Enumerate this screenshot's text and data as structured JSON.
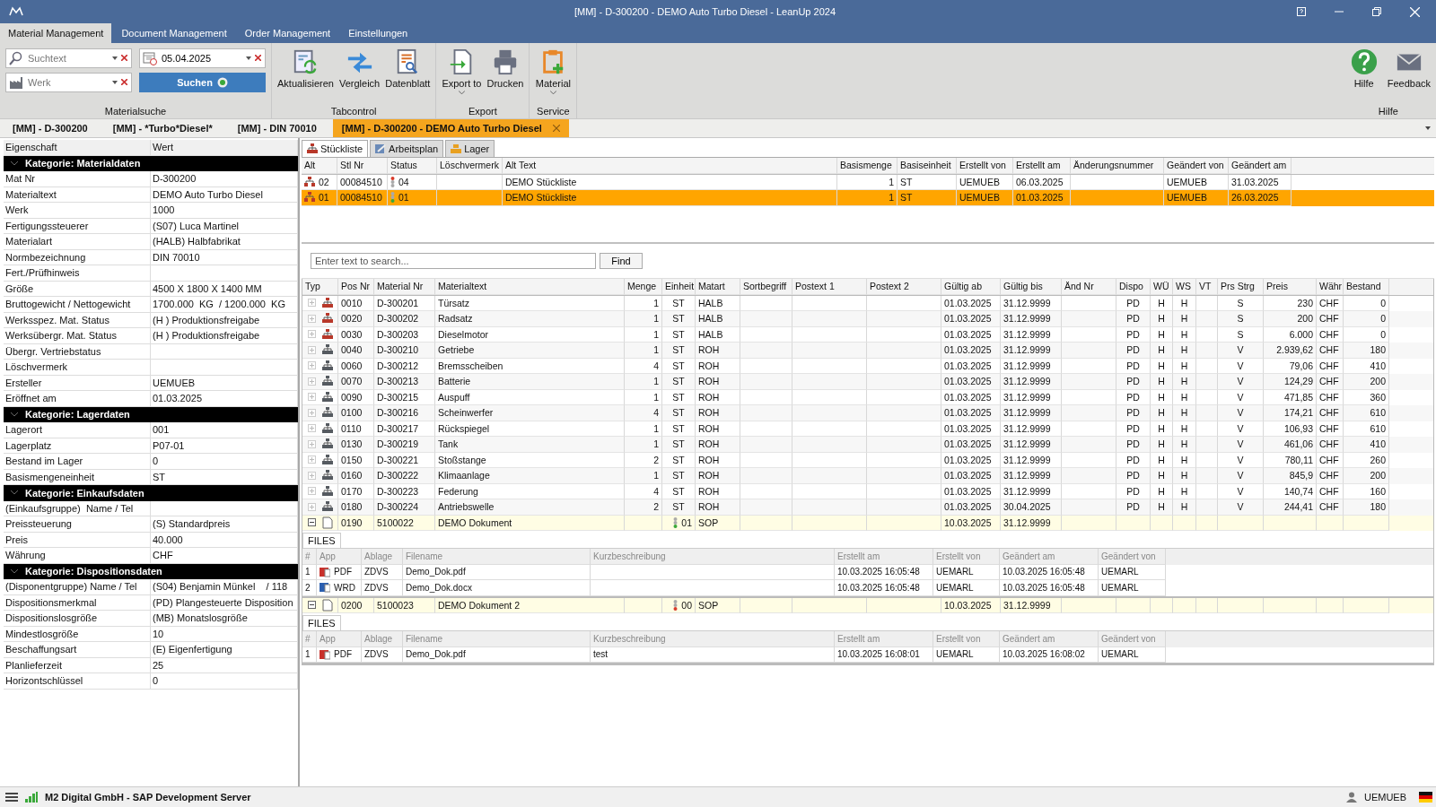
{
  "window": {
    "title": "[MM] - D-300200 - DEMO Auto Turbo Diesel - LeanUp 2024"
  },
  "ribbon_tabs": [
    {
      "label": "Material Management",
      "selected": true
    },
    {
      "label": "Document Management",
      "selected": false
    },
    {
      "label": "Order Management",
      "selected": false
    },
    {
      "label": "Einstellungen",
      "selected": false
    }
  ],
  "material_search": {
    "label": "Materialsuche",
    "search_placeholder": "Suchtext",
    "date": "05.04.2025",
    "plant_placeholder": "Werk",
    "button": "Suchen"
  },
  "ribbon_groups": [
    {
      "label": "Tabcontrol",
      "buttons": [
        {
          "label": "Aktualisieren",
          "dropdown": false
        },
        {
          "label": "Vergleich",
          "dropdown": false
        },
        {
          "label": "Datenblatt",
          "dropdown": false
        }
      ]
    },
    {
      "label": "Export",
      "buttons": [
        {
          "label": "Export to",
          "dropdown": true
        },
        {
          "label": "Drucken",
          "dropdown": false
        }
      ]
    },
    {
      "label": "Service",
      "buttons": [
        {
          "label": "Material",
          "dropdown": true
        }
      ]
    },
    {
      "label": "Hilfe",
      "buttons": [
        {
          "label": "Hilfe",
          "dropdown": false
        },
        {
          "label": "Feedback",
          "dropdown": false
        }
      ]
    }
  ],
  "document_tabs": [
    {
      "label": "[MM] - D-300200",
      "selected": false
    },
    {
      "label": "[MM] - *Turbo*Diesel*",
      "selected": false
    },
    {
      "label": "[MM] - DIN 70010",
      "selected": false
    },
    {
      "label": "[MM] - D-300200 - DEMO Auto Turbo Diesel",
      "selected": true
    }
  ],
  "property_grid": {
    "columns": [
      "Eigenschaft",
      "Wert"
    ],
    "categories": [
      {
        "title": "Kategorie: Materialdaten",
        "expanded": true,
        "rows": [
          [
            "Mat Nr",
            "D-300200"
          ],
          [
            "Materialtext",
            "DEMO Auto Turbo Diesel"
          ],
          [
            "Werk",
            "1000"
          ],
          [
            "Fertigungssteuerer",
            "(S07) Luca Martinel"
          ],
          [
            "Materialart",
            "(HALB) Halbfabrikat"
          ],
          [
            "Normbezeichnung",
            "DIN 70010"
          ],
          [
            "Fert./Prüfhinweis",
            null
          ],
          [
            "Größe",
            "4500 X 1800 X 1400 MM"
          ],
          [
            "Bruttogewicht / Nettogewicht",
            "1700.000  KG  / 1200.000  KG"
          ],
          [
            "Werksspez. Mat. Status",
            "(H ) Produktionsfreigabe"
          ],
          [
            "Werksübergr. Mat. Status",
            "(H ) Produktionsfreigabe"
          ],
          [
            "Übergr. Vertriebstatus",
            null
          ],
          [
            "Löschvermerk",
            null
          ],
          [
            "Ersteller",
            "UEMUEB"
          ],
          [
            "Eröffnet am",
            "01.03.2025"
          ]
        ]
      },
      {
        "title": "Kategorie: Lagerdaten",
        "expanded": true,
        "rows": [
          [
            "Lagerort",
            "001"
          ],
          [
            "Lagerplatz",
            "P07-01"
          ],
          [
            "Bestand im Lager",
            "0"
          ],
          [
            "Basismengeneinheit",
            "ST"
          ]
        ]
      },
      {
        "title": "Kategorie: Einkaufsdaten",
        "expanded": true,
        "rows": [
          [
            "(Einkaufsgruppe)  Name / Tel",
            null
          ],
          [
            "Preissteuerung",
            "(S) Standardpreis"
          ],
          [
            "Preis",
            "40.000"
          ],
          [
            "Währung",
            "CHF"
          ]
        ]
      },
      {
        "title": "Kategorie: Dispositionsdaten",
        "expanded": true,
        "rows": [
          [
            "(Disponentgruppe) Name / Tel",
            "(S04) Benjamin Münkel    / 118"
          ],
          [
            "Dispositionsmerkmal",
            "(PD) Plangesteuerte Disposition"
          ],
          [
            "Dispositionslosgröße",
            "(MB) Monatslosgröße"
          ],
          [
            "Mindestlosgröße",
            "10"
          ],
          [
            "Beschaffungsart",
            "(E) Eigenfertigung"
          ],
          [
            "Planlieferzeit",
            "25"
          ],
          [
            "Horizontschlüssel",
            "0"
          ]
        ]
      }
    ]
  },
  "sub_tabs": [
    {
      "label": "Stückliste",
      "selected": true
    },
    {
      "label": "Arbeitsplan",
      "selected": false
    },
    {
      "label": "Lager",
      "selected": false
    }
  ],
  "bom_versions": {
    "columns": [
      "Alt",
      "Stl Nr",
      "Status",
      "Löschvermerk",
      "Alt Text",
      "Basismenge",
      "Basiseinheit",
      "Erstellt von",
      "Erstellt am",
      "Änderungsnummer",
      "Geändert von",
      "Geändert am"
    ],
    "rows": [
      {
        "selected": false,
        "color": "#d83b2b",
        "cells": [
          "02",
          "00084510",
          "04",
          null,
          "DEMO Stückliste",
          "1",
          "ST",
          "UEMUEB",
          "06.03.2025",
          null,
          "UEMUEB",
          "31.03.2025"
        ]
      },
      {
        "selected": true,
        "color": "#3aa83a",
        "cells": [
          "01",
          "00084510",
          "01",
          null,
          "DEMO Stückliste",
          "1",
          "ST",
          "UEMUEB",
          "01.03.2025",
          null,
          "UEMUEB",
          "26.03.2025"
        ]
      }
    ]
  },
  "find": {
    "placeholder": "Enter text to search...",
    "button": "Find"
  },
  "items": {
    "type_column": "Typ",
    "columns": [
      "Pos Nr",
      "Material Nr",
      "Materialtext",
      "Menge",
      "Einheit",
      "Matart",
      "Sortbegriff",
      "Postext 1",
      "Postext 2",
      "Gültig ab",
      "Gültig bis",
      "Änd Nr",
      "Dispo",
      "WÜ",
      "WS",
      "VT",
      "Prs Strg",
      "Preis",
      "Währ",
      "Bestand"
    ],
    "rows": [
      {
        "kind": "halb",
        "expanded": false,
        "cells": [
          "0010",
          "D-300201",
          "Türsatz",
          "1",
          "ST",
          "HALB",
          null,
          null,
          null,
          "01.03.2025",
          "31.12.9999",
          null,
          "PD",
          "H",
          "H",
          null,
          "S",
          "230",
          "CHF",
          "0"
        ]
      },
      {
        "kind": "halb",
        "expanded": false,
        "cells": [
          "0020",
          "D-300202",
          "Radsatz",
          "1",
          "ST",
          "HALB",
          null,
          null,
          null,
          "01.03.2025",
          "31.12.9999",
          null,
          "PD",
          "H",
          "H",
          null,
          "S",
          "200",
          "CHF",
          "0"
        ]
      },
      {
        "kind": "halb",
        "expanded": false,
        "cells": [
          "0030",
          "D-300203",
          "Dieselmotor",
          "1",
          "ST",
          "HALB",
          null,
          null,
          null,
          "01.03.2025",
          "31.12.9999",
          null,
          "PD",
          "H",
          "H",
          null,
          "S",
          "6.000",
          "CHF",
          "0"
        ]
      },
      {
        "kind": "roh",
        "expanded": false,
        "cells": [
          "0040",
          "D-300210",
          "Getriebe",
          "1",
          "ST",
          "ROH",
          null,
          null,
          null,
          "01.03.2025",
          "31.12.9999",
          null,
          "PD",
          "H",
          "H",
          null,
          "V",
          "2.939,62",
          "CHF",
          "180"
        ]
      },
      {
        "kind": "roh",
        "expanded": false,
        "cells": [
          "0060",
          "D-300212",
          "Bremsscheiben",
          "4",
          "ST",
          "ROH",
          null,
          null,
          null,
          "01.03.2025",
          "31.12.9999",
          null,
          "PD",
          "H",
          "H",
          null,
          "V",
          "79,06",
          "CHF",
          "410"
        ]
      },
      {
        "kind": "roh",
        "expanded": false,
        "cells": [
          "0070",
          "D-300213",
          "Batterie",
          "1",
          "ST",
          "ROH",
          null,
          null,
          null,
          "01.03.2025",
          "31.12.9999",
          null,
          "PD",
          "H",
          "H",
          null,
          "V",
          "124,29",
          "CHF",
          "200"
        ]
      },
      {
        "kind": "roh",
        "expanded": false,
        "cells": [
          "0090",
          "D-300215",
          "Auspuff",
          "1",
          "ST",
          "ROH",
          null,
          null,
          null,
          "01.03.2025",
          "31.12.9999",
          null,
          "PD",
          "H",
          "H",
          null,
          "V",
          "471,85",
          "CHF",
          "360"
        ]
      },
      {
        "kind": "roh",
        "expanded": false,
        "cells": [
          "0100",
          "D-300216",
          "Scheinwerfer",
          "4",
          "ST",
          "ROH",
          null,
          null,
          null,
          "01.03.2025",
          "31.12.9999",
          null,
          "PD",
          "H",
          "H",
          null,
          "V",
          "174,21",
          "CHF",
          "610"
        ]
      },
      {
        "kind": "roh",
        "expanded": false,
        "cells": [
          "0110",
          "D-300217",
          "Rückspiegel",
          "1",
          "ST",
          "ROH",
          null,
          null,
          null,
          "01.03.2025",
          "31.12.9999",
          null,
          "PD",
          "H",
          "H",
          null,
          "V",
          "106,93",
          "CHF",
          "610"
        ]
      },
      {
        "kind": "roh",
        "expanded": false,
        "cells": [
          "0130",
          "D-300219",
          "Tank",
          "1",
          "ST",
          "ROH",
          null,
          null,
          null,
          "01.03.2025",
          "31.12.9999",
          null,
          "PD",
          "H",
          "H",
          null,
          "V",
          "461,06",
          "CHF",
          "410"
        ]
      },
      {
        "kind": "roh",
        "expanded": false,
        "cells": [
          "0150",
          "D-300221",
          "Stoßstange",
          "2",
          "ST",
          "ROH",
          null,
          null,
          null,
          "01.03.2025",
          "31.12.9999",
          null,
          "PD",
          "H",
          "H",
          null,
          "V",
          "780,11",
          "CHF",
          "260"
        ]
      },
      {
        "kind": "roh",
        "expanded": false,
        "cells": [
          "0160",
          "D-300222",
          "Klimaanlage",
          "1",
          "ST",
          "ROH",
          null,
          null,
          null,
          "01.03.2025",
          "31.12.9999",
          null,
          "PD",
          "H",
          "H",
          null,
          "V",
          "845,9",
          "CHF",
          "200"
        ]
      },
      {
        "kind": "roh",
        "expanded": false,
        "cells": [
          "0170",
          "D-300223",
          "Federung",
          "4",
          "ST",
          "ROH",
          null,
          null,
          null,
          "01.03.2025",
          "31.12.9999",
          null,
          "PD",
          "H",
          "H",
          null,
          "V",
          "140,74",
          "CHF",
          "160"
        ]
      },
      {
        "kind": "roh",
        "expanded": false,
        "cells": [
          "0180",
          "D-300224",
          "Antriebswelle",
          "2",
          "ST",
          "ROH",
          null,
          null,
          null,
          "01.03.2025",
          "30.04.2025",
          null,
          "PD",
          "H",
          "H",
          null,
          "V",
          "244,41",
          "CHF",
          "180"
        ]
      },
      {
        "kind": "document",
        "expanded": true,
        "color": "#3aa83a",
        "cells": [
          "0190",
          "5100022",
          "DEMO Dokument",
          null,
          "01",
          "SOP",
          null,
          null,
          null,
          "10.03.2025",
          "31.12.9999",
          null,
          null,
          null,
          null,
          null,
          null,
          null,
          null,
          null
        ],
        "files_label": "FILES",
        "file_columns": [
          "#",
          "App",
          "Ablage",
          "Filename",
          "Kurzbeschreibung",
          "Erstellt am",
          "Erstellt von",
          "Geändert am",
          "Geändert von"
        ],
        "files": [
          {
            "kind": "pdf",
            "cells": [
              "1",
              "PDF",
              "ZDVS",
              "Demo_Dok.pdf",
              null,
              "10.03.2025 16:05:48",
              "UEMARL",
              "10.03.2025 16:05:48",
              "UEMARL"
            ]
          },
          {
            "kind": "wrd",
            "cells": [
              "2",
              "WRD",
              "ZDVS",
              "Demo_Dok.docx",
              null,
              "10.03.2025 16:05:48",
              "UEMARL",
              "10.03.2025 16:05:48",
              "UEMARL"
            ]
          }
        ]
      },
      {
        "kind": "document",
        "expanded": true,
        "color": "#d83b2b",
        "cells": [
          "0200",
          "5100023",
          "DEMO Dokument 2",
          null,
          "00",
          "SOP",
          null,
          null,
          null,
          "10.03.2025",
          "31.12.9999",
          null,
          null,
          null,
          null,
          null,
          null,
          null,
          null,
          null
        ],
        "files_label": "FILES",
        "file_columns": [
          "#",
          "App",
          "Ablage",
          "Filename",
          "Kurzbeschreibung",
          "Erstellt am",
          "Erstellt von",
          "Geändert am",
          "Geändert von"
        ],
        "files": [
          {
            "kind": "pdf",
            "cells": [
              "1",
              "PDF",
              "ZDVS",
              "Demo_Dok.pdf",
              "test",
              "10.03.2025 16:08:01",
              "UEMARL",
              "10.03.2025 16:08:02",
              "UEMARL"
            ]
          }
        ]
      }
    ]
  },
  "status_bar": {
    "server": "M2 Digital GmbH - SAP Development Server",
    "user": "UEMUEB"
  }
}
